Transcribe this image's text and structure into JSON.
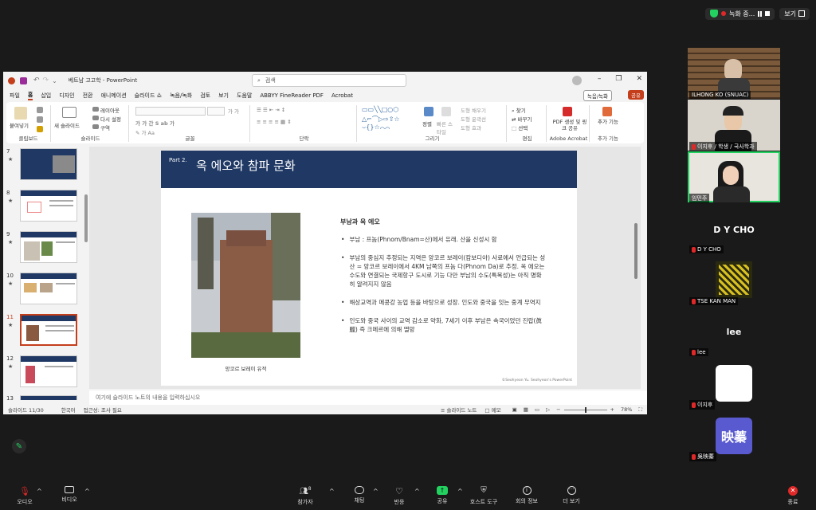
{
  "zoom_top": {
    "recording_label": "녹화 중...",
    "view_label": "보기"
  },
  "ppt": {
    "window_title": "베트남 고고학 - PowerPoint",
    "search_placeholder": "검색",
    "menu": [
      "파일",
      "홈",
      "삽입",
      "디자인",
      "전환",
      "애니메이션",
      "슬라이드 쇼",
      "녹음/녹화",
      "검토",
      "보기",
      "도움말",
      "ABBYY FineReader PDF",
      "Acrobat"
    ],
    "record_btn": "녹음/녹화",
    "share_btn": "공유",
    "ribbon": {
      "paste": "붙여넣기",
      "clipboard": "클립보드",
      "new_slide": "새 슬라이드",
      "layout": "레이아웃",
      "reset": "다시 설정",
      "section": "구역",
      "slides": "슬라이드",
      "font": "글꼴",
      "paragraph": "단락",
      "arrange": "정렬",
      "quick_styles": "빠른 스타일",
      "shape_fill": "도형 채우기",
      "shape_outline": "도형 윤곽선",
      "shape_effects": "도형 효과",
      "drawing": "그리기",
      "find": "찾기",
      "replace": "바꾸기",
      "select": "선택",
      "editing": "편집",
      "pdf_share": "PDF 생성 및 링크 공유",
      "acrobat": "Adobe Acrobat",
      "addins": "추가 기능",
      "addins_group": "추가 기능"
    },
    "thumbs": [
      {
        "num": "7"
      },
      {
        "num": "8"
      },
      {
        "num": "9"
      },
      {
        "num": "10"
      },
      {
        "num": "11"
      },
      {
        "num": "12"
      },
      {
        "num": "13"
      }
    ],
    "slide": {
      "part": "Part 2.",
      "title": "옥 에오와 참파 문화",
      "caption": "앙코르 보레이 유적",
      "heading": "부남과 옥 에오",
      "bullets": [
        "부남 : 프놈(Phnom/Bnam=산)에서 유래. 산을 신성시 함",
        "부남의 중심지 추정되는 지역은 앙코르 보레이(캄보디아) 사료에서 언급되는 성산 = 앙코르 보레이에서 4KM 남쪽의 프놈 다(Phnom Da)로 추정. 옥 에오는 수도와 연결되는 국제항구 도시로 기능 다만 부남의 수도(특목성)는 아직 명확히 알려지지 않음",
        "해상교역과 메콩강 농업 등을 바탕으로 성장. 인도와 중국을 잇는 중계 무역지",
        "인도와 중국 사이의 교역 감소로 약화, 7세기 이후 부남은 속국이었던 진랍(眞臘) 즉 크메르에 의해 멸망"
      ],
      "credit": "©Seohyeon Yu. Seohyeon's PowerPoint"
    },
    "notes_placeholder": "여기에 슬라이드 노트의 내용을 입력하십시오",
    "status": {
      "slide_info": "슬라이드 11/30",
      "lang": "한국어",
      "accessibility": "접근성: 조사 필요",
      "notes": "슬라이드 노트",
      "comments": "메모",
      "zoom": "78%"
    }
  },
  "participants": [
    {
      "name": "ILHONG KO (SNUAC)"
    },
    {
      "name": "이지후 / 학생 / 국사학과"
    },
    {
      "name": "임민주"
    },
    {
      "bigname": "D Y CHO",
      "name": "D Y CHO"
    },
    {
      "name": "TSE KAN MAN"
    },
    {
      "bigname": "lee",
      "name": "lee"
    },
    {
      "name": "이지후"
    },
    {
      "avatar_text": "映蓁",
      "name": "吳映蓁"
    }
  ],
  "toolbar": {
    "audio": "오디오",
    "video": "비디오",
    "participants": "참가자",
    "participants_count": "8",
    "chat": "채팅",
    "reactions": "반응",
    "share": "공유",
    "host_tools": "호스트 도구",
    "meeting_info": "회의 정보",
    "more": "더 보기",
    "end": "종료"
  }
}
